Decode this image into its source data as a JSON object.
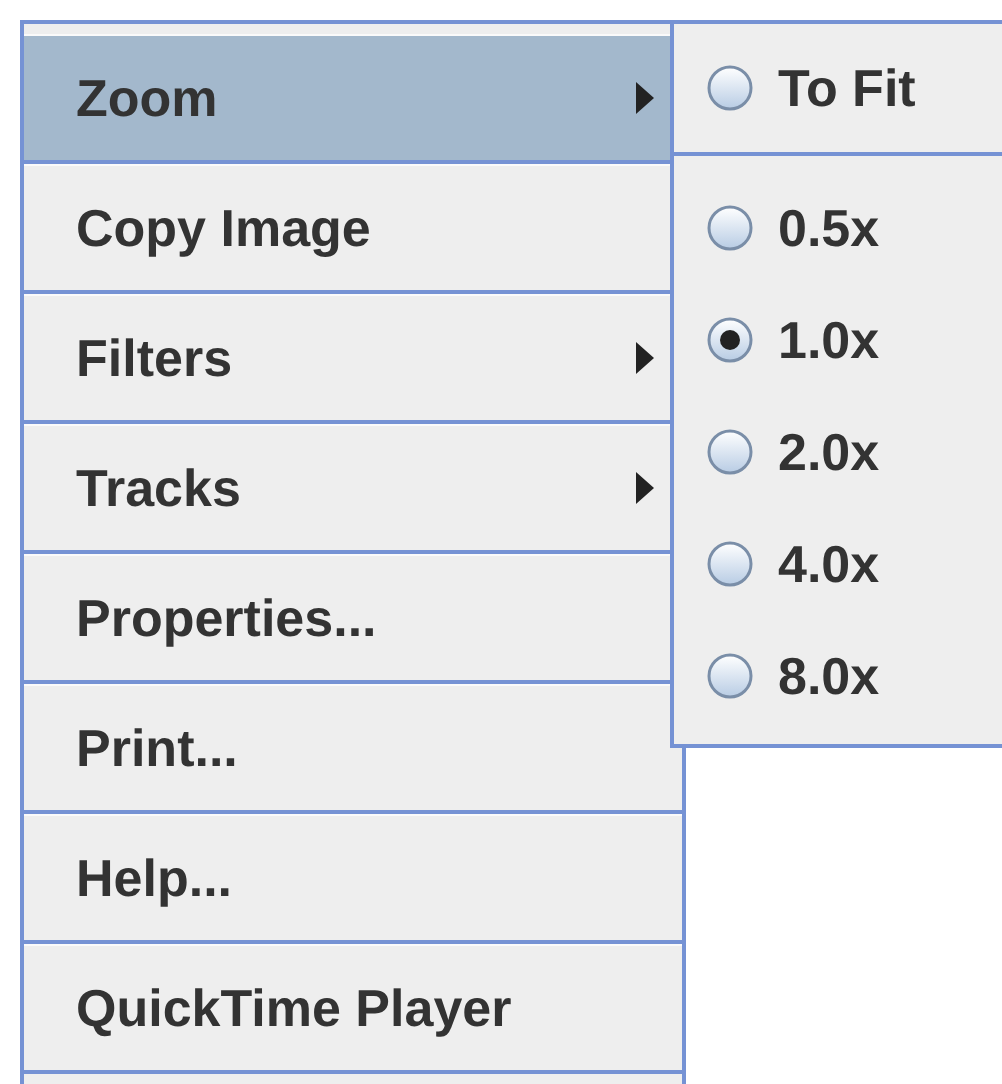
{
  "menu": {
    "items": [
      {
        "label": "Zoom",
        "kind": "submenu",
        "selected": true
      },
      {
        "label": "Copy Image",
        "kind": "action",
        "selected": false
      },
      {
        "label": "Filters",
        "kind": "submenu",
        "selected": false
      },
      {
        "label": "Tracks",
        "kind": "submenu",
        "selected": false
      },
      {
        "label": "Properties...",
        "kind": "action",
        "selected": false
      },
      {
        "label": "Print...",
        "kind": "action",
        "selected": false
      },
      {
        "label": "Help...",
        "kind": "action",
        "selected": false
      },
      {
        "label": "QuickTime Player",
        "kind": "action",
        "selected": false
      }
    ]
  },
  "zoom_submenu": {
    "groups": [
      [
        {
          "label": "To Fit",
          "selected": false
        }
      ],
      [
        {
          "label": "0.5x",
          "selected": false
        },
        {
          "label": "1.0x",
          "selected": true
        },
        {
          "label": "2.0x",
          "selected": false
        },
        {
          "label": "4.0x",
          "selected": false
        },
        {
          "label": "8.0x",
          "selected": false
        }
      ]
    ]
  }
}
